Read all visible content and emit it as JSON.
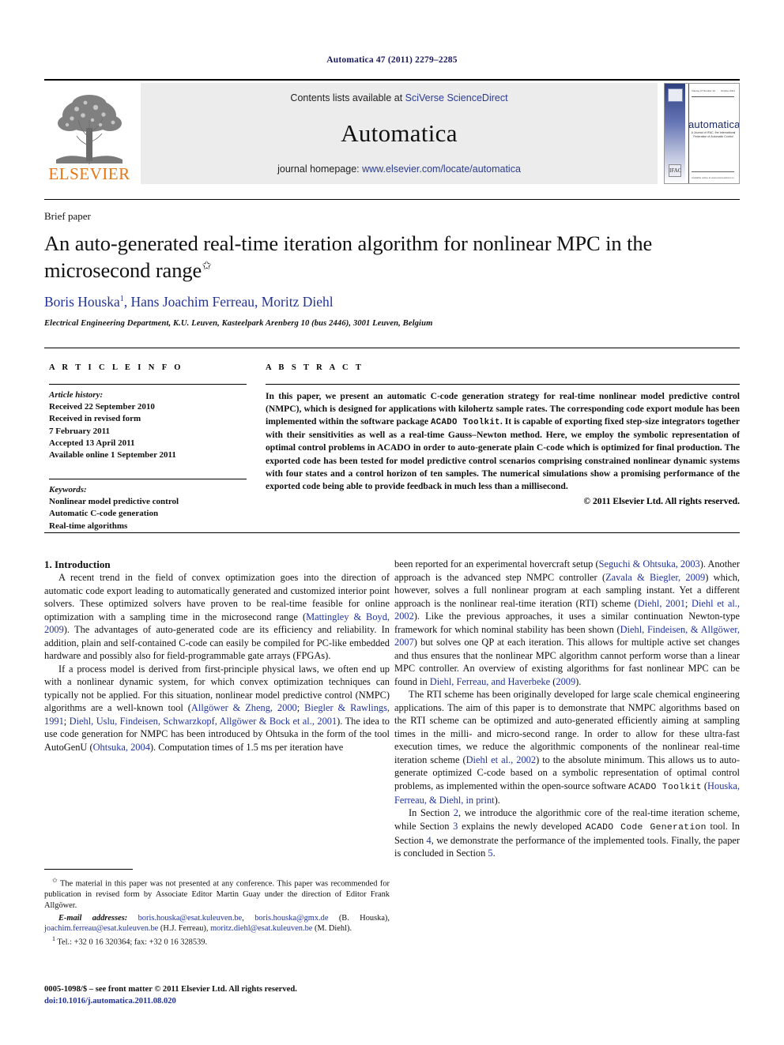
{
  "running_head": "Automatica 47 (2011) 2279–2285",
  "masthead": {
    "publisher_logo_text": "ELSEVIER",
    "contents_prefix": "Contents lists available at ",
    "contents_link": "SciVerse ScienceDirect",
    "journal_name": "Automatica",
    "homepage_prefix": "journal homepage: ",
    "homepage_link": "www.elsevier.com/locate/automatica",
    "cover": {
      "title": "automatica",
      "subtitle": "A Journal of IFAC, the International Federation of Automatic Control",
      "header_left": "Volume 47 Number 10",
      "header_right": "October 2011",
      "footer_note": "Available online at www.sciencedirect.com",
      "badge_bottom": "IFAC"
    }
  },
  "article": {
    "type_label": "Brief paper",
    "title": "An auto-generated real-time iteration algorithm for nonlinear MPC in the microsecond range",
    "title_footnote_marker": "✩",
    "authors": "Boris Houska , Hans Joachim Ferreau, Moritz Diehl",
    "author_footnote_marker": "1",
    "affiliation": "Electrical Engineering Department, K.U. Leuven, Kasteelpark Arenberg 10 (bus 2446), 3001 Leuven, Belgium"
  },
  "info": {
    "heading": "A R T I C L E   I N F O",
    "history_label": "Article history:",
    "history": [
      "Received 22 September 2010",
      "Received in revised form",
      "7 February 2011",
      "Accepted 13 April 2011",
      "Available online 1 September 2011"
    ],
    "keywords_label": "Keywords:",
    "keywords": [
      "Nonlinear model predictive control",
      "Automatic C-code generation",
      "Real-time algorithms"
    ]
  },
  "abstract": {
    "heading": "A B S T R A C T",
    "part1": "In this paper, we present an automatic C-code generation strategy for real-time nonlinear model predictive control (NMPC), which is designed for applications with kilohertz sample rates. The corresponding code export module has been implemented within the software package ",
    "acado_toolkit_mono": "ACADO Toolkit",
    "part2": ". It is capable of exporting fixed step-size integrators together with their sensitivities as well as a real-time Gauss–Newton method. Here, we employ the symbolic representation of optimal control problems in ACADO in order to auto-generate plain C-code which is optimized for final production. The exported code has been tested for model predictive control scenarios comprising constrained nonlinear dynamic systems with four states and a control horizon of ten samples. The numerical simulations show a promising performance of the exported code being able to provide feedback in much less than a millisecond.",
    "copyright": "© 2011 Elsevier Ltd. All rights reserved."
  },
  "body": {
    "section_number_title": "1. Introduction",
    "left": {
      "p1_a": "A recent trend in the field of convex optimization goes into the direction of automatic code export leading to automatically generated and customized interior point solvers. These optimized solvers have proven to be real-time feasible for online optimization with a sampling time in the microsecond range (",
      "p1_cite1": "Mattingley & Boyd, 2009",
      "p1_b": "). The advantages of auto-generated code are its efficiency and reliability. In addition, plain and self-contained C-code can easily be compiled for PC-like embedded hardware and possibly also for field-programmable gate arrays (FPGAs).",
      "p2_a": "If a process model is derived from first-principle physical laws, we often end up with a nonlinear dynamic system, for which convex optimization techniques can typically not be applied. For this situation, nonlinear model predictive control (NMPC) algorithms are a well-known tool (",
      "p2_cite1": "Allgöwer & Zheng, 2000",
      "p2_sep1": "; ",
      "p2_cite2": "Biegler & Rawlings, 1991",
      "p2_sep2": "; ",
      "p2_cite3": "Diehl, Uslu, Findeisen, Schwarzkopf, Allgöwer & Bock et al., 2001",
      "p2_b": "). The idea to use code generation for NMPC has been introduced by Ohtsuka in the form of the tool AutoGenU (",
      "p2_cite4": "Ohtsuka, 2004",
      "p2_c": "). Computation times of 1.5 ms per iteration have"
    },
    "right": {
      "p1_a": "been reported for an experimental hovercraft setup (",
      "p1_cite1": "Seguchi & Ohtsuka, 2003",
      "p1_b": "). Another approach is the advanced step NMPC controller (",
      "p1_cite2": "Zavala & Biegler, 2009",
      "p1_c": ") which, however, solves a full nonlinear program at each sampling instant. Yet a different approach is the nonlinear real-time iteration (RTI) scheme (",
      "p1_cite3": "Diehl, 2001",
      "p1_sep1": "; ",
      "p1_cite4": "Diehl et al., 2002",
      "p1_d": "). Like the previous approaches, it uses a similar continuation Newton-type framework for which nominal stability has been shown (",
      "p1_cite5": "Diehl, Findeisen, & Allgöwer, 2007",
      "p1_e": ") but solves one QP at each iteration. This allows for multiple active set changes and thus ensures that the nonlinear MPC algorithm cannot perform worse than a linear MPC controller. An overview of existing algorithms for fast nonlinear MPC can be found in ",
      "p1_cite6": "Diehl, Ferreau, and Haverbeke",
      "p1_f": " (",
      "p1_cite7": "2009",
      "p1_g": ").",
      "p2_a": "The RTI scheme has been originally developed for large scale chemical engineering applications. The aim of this paper is to demonstrate that NMPC algorithms based on the RTI scheme can be optimized and auto-generated efficiently aiming at sampling times in the milli- and micro-second range. In order to allow for these ultra-fast execution times, we reduce the algorithmic components of the nonlinear real-time iteration scheme (",
      "p2_cite1": "Diehl et al., 2002",
      "p2_b": ") to the absolute minimum. This allows us to auto-generate optimized C-code based on a symbolic representation of optimal control problems, as implemented within the open-source software ",
      "p2_mono": "ACADO Toolkit",
      "p2_c": " (",
      "p2_cite2": "Houska, Ferreau, & Diehl, in print",
      "p2_d": ").",
      "p3_a": "In Section ",
      "p3_ref1": "2",
      "p3_b": ", we introduce the algorithmic core of the real-time iteration scheme, while Section ",
      "p3_ref2": "3",
      "p3_c": " explains the newly developed ",
      "p3_mono": "ACADO Code Generation",
      "p3_d": " tool. In Section ",
      "p3_ref3": "4",
      "p3_e": ", we demonstrate the performance of the implemented tools. Finally, the paper is concluded in Section ",
      "p3_ref4": "5",
      "p3_f": "."
    }
  },
  "footnotes": {
    "star_marker": "✩",
    "star_text": " The material in this paper was not presented at any conference. This paper was recommended for publication in revised form by Associate Editor Martin Guay under the direction of Editor Frank Allgöwer.",
    "email_label": "E-mail addresses:",
    "email1": "boris.houska@esat.kuleuven.be",
    "email2": "boris.houska@gmx.de",
    "email_owner1": " (B. Houska), ",
    "email3": "joachim.ferreau@esat.kuleuven.be",
    "email_owner2": " (H.J. Ferreau), ",
    "email4": "moritz.diehl@esat.kuleuven.be",
    "email_owner3": " (M. Diehl).",
    "tel_marker": "1",
    "tel_text": " Tel.: +32 0 16 320364; fax: +32 0 16 328539.",
    "issn_line": "0005-1098/$ – see front matter © 2011 Elsevier Ltd. All rights reserved.",
    "doi_line": "doi:10.1016/j.automatica.2011.08.020"
  },
  "colors": {
    "link_blue": "#2b3b8f",
    "cite_blue": "#21339b",
    "elsevier_orange": "#E87511",
    "band_gray": "#ececec"
  }
}
